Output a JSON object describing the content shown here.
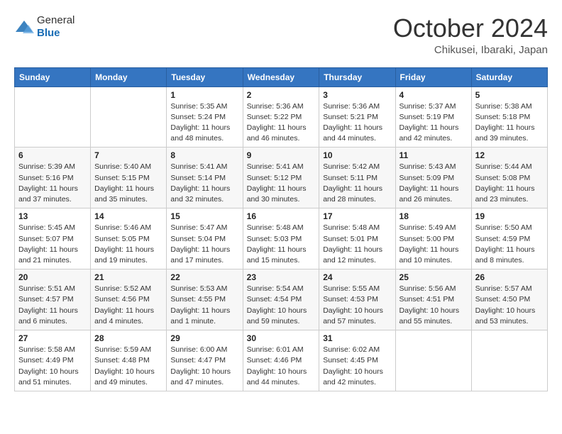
{
  "logo": {
    "general": "General",
    "blue": "Blue"
  },
  "title": "October 2024",
  "location": "Chikusei, Ibaraki, Japan",
  "headers": [
    "Sunday",
    "Monday",
    "Tuesday",
    "Wednesday",
    "Thursday",
    "Friday",
    "Saturday"
  ],
  "weeks": [
    [
      {
        "day": "",
        "info": ""
      },
      {
        "day": "",
        "info": ""
      },
      {
        "day": "1",
        "info": "Sunrise: 5:35 AM\nSunset: 5:24 PM\nDaylight: 11 hours and 48 minutes."
      },
      {
        "day": "2",
        "info": "Sunrise: 5:36 AM\nSunset: 5:22 PM\nDaylight: 11 hours and 46 minutes."
      },
      {
        "day": "3",
        "info": "Sunrise: 5:36 AM\nSunset: 5:21 PM\nDaylight: 11 hours and 44 minutes."
      },
      {
        "day": "4",
        "info": "Sunrise: 5:37 AM\nSunset: 5:19 PM\nDaylight: 11 hours and 42 minutes."
      },
      {
        "day": "5",
        "info": "Sunrise: 5:38 AM\nSunset: 5:18 PM\nDaylight: 11 hours and 39 minutes."
      }
    ],
    [
      {
        "day": "6",
        "info": "Sunrise: 5:39 AM\nSunset: 5:16 PM\nDaylight: 11 hours and 37 minutes."
      },
      {
        "day": "7",
        "info": "Sunrise: 5:40 AM\nSunset: 5:15 PM\nDaylight: 11 hours and 35 minutes."
      },
      {
        "day": "8",
        "info": "Sunrise: 5:41 AM\nSunset: 5:14 PM\nDaylight: 11 hours and 32 minutes."
      },
      {
        "day": "9",
        "info": "Sunrise: 5:41 AM\nSunset: 5:12 PM\nDaylight: 11 hours and 30 minutes."
      },
      {
        "day": "10",
        "info": "Sunrise: 5:42 AM\nSunset: 5:11 PM\nDaylight: 11 hours and 28 minutes."
      },
      {
        "day": "11",
        "info": "Sunrise: 5:43 AM\nSunset: 5:09 PM\nDaylight: 11 hours and 26 minutes."
      },
      {
        "day": "12",
        "info": "Sunrise: 5:44 AM\nSunset: 5:08 PM\nDaylight: 11 hours and 23 minutes."
      }
    ],
    [
      {
        "day": "13",
        "info": "Sunrise: 5:45 AM\nSunset: 5:07 PM\nDaylight: 11 hours and 21 minutes."
      },
      {
        "day": "14",
        "info": "Sunrise: 5:46 AM\nSunset: 5:05 PM\nDaylight: 11 hours and 19 minutes."
      },
      {
        "day": "15",
        "info": "Sunrise: 5:47 AM\nSunset: 5:04 PM\nDaylight: 11 hours and 17 minutes."
      },
      {
        "day": "16",
        "info": "Sunrise: 5:48 AM\nSunset: 5:03 PM\nDaylight: 11 hours and 15 minutes."
      },
      {
        "day": "17",
        "info": "Sunrise: 5:48 AM\nSunset: 5:01 PM\nDaylight: 11 hours and 12 minutes."
      },
      {
        "day": "18",
        "info": "Sunrise: 5:49 AM\nSunset: 5:00 PM\nDaylight: 11 hours and 10 minutes."
      },
      {
        "day": "19",
        "info": "Sunrise: 5:50 AM\nSunset: 4:59 PM\nDaylight: 11 hours and 8 minutes."
      }
    ],
    [
      {
        "day": "20",
        "info": "Sunrise: 5:51 AM\nSunset: 4:57 PM\nDaylight: 11 hours and 6 minutes."
      },
      {
        "day": "21",
        "info": "Sunrise: 5:52 AM\nSunset: 4:56 PM\nDaylight: 11 hours and 4 minutes."
      },
      {
        "day": "22",
        "info": "Sunrise: 5:53 AM\nSunset: 4:55 PM\nDaylight: 11 hours and 1 minute."
      },
      {
        "day": "23",
        "info": "Sunrise: 5:54 AM\nSunset: 4:54 PM\nDaylight: 10 hours and 59 minutes."
      },
      {
        "day": "24",
        "info": "Sunrise: 5:55 AM\nSunset: 4:53 PM\nDaylight: 10 hours and 57 minutes."
      },
      {
        "day": "25",
        "info": "Sunrise: 5:56 AM\nSunset: 4:51 PM\nDaylight: 10 hours and 55 minutes."
      },
      {
        "day": "26",
        "info": "Sunrise: 5:57 AM\nSunset: 4:50 PM\nDaylight: 10 hours and 53 minutes."
      }
    ],
    [
      {
        "day": "27",
        "info": "Sunrise: 5:58 AM\nSunset: 4:49 PM\nDaylight: 10 hours and 51 minutes."
      },
      {
        "day": "28",
        "info": "Sunrise: 5:59 AM\nSunset: 4:48 PM\nDaylight: 10 hours and 49 minutes."
      },
      {
        "day": "29",
        "info": "Sunrise: 6:00 AM\nSunset: 4:47 PM\nDaylight: 10 hours and 47 minutes."
      },
      {
        "day": "30",
        "info": "Sunrise: 6:01 AM\nSunset: 4:46 PM\nDaylight: 10 hours and 44 minutes."
      },
      {
        "day": "31",
        "info": "Sunrise: 6:02 AM\nSunset: 4:45 PM\nDaylight: 10 hours and 42 minutes."
      },
      {
        "day": "",
        "info": ""
      },
      {
        "day": "",
        "info": ""
      }
    ]
  ]
}
